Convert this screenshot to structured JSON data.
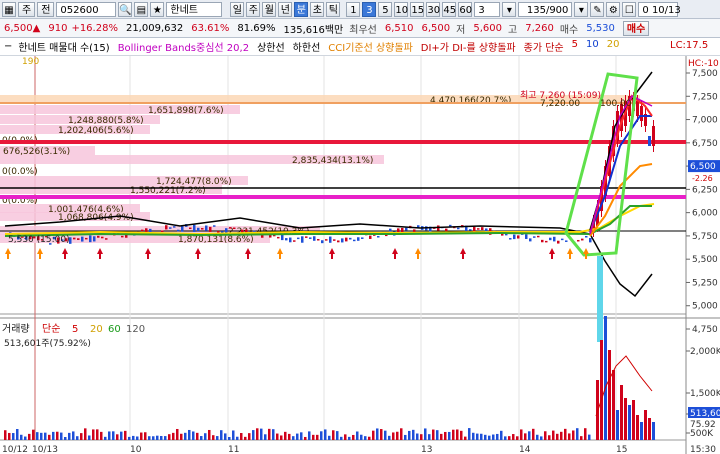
{
  "toolbar": {
    "menu_button": "주",
    "prev_button": "전",
    "stock_code": "052600",
    "stock_name": "한네트",
    "periods": [
      "일",
      "주",
      "월",
      "년",
      "분",
      "초",
      "틱"
    ],
    "active_period": "분",
    "intervals": [
      "1",
      "3",
      "5",
      "10",
      "15",
      "30",
      "45",
      "60"
    ],
    "active_interval": "3",
    "select_value": "3",
    "count": "135/900",
    "date_value": "0 10/13"
  },
  "quote": {
    "price": "6,500",
    "change": "910",
    "change_pct": "+16.28%",
    "volume": "21,009,632",
    "ratio1": "63.61%",
    "ratio2": "81.69%",
    "amount": "135,616백만",
    "best_label": "최우선",
    "best_sell": "6,510",
    "best_buy": "6,500",
    "low_label": "저",
    "low": "5,600",
    "high_label": "고",
    "high": "7,260",
    "ask_label": "매수",
    "ask_value": "5,530",
    "buy_button": "매수"
  },
  "indicators_bar": {
    "items": [
      {
        "text": "한네트 매물대 수(15)",
        "color": "#000000"
      },
      {
        "text": "Bollinger Bands중심선 20,2",
        "color": "#c000c0"
      },
      {
        "text": "상한선",
        "color": "#000000"
      },
      {
        "text": "하한선",
        "color": "#000000"
      },
      {
        "text": "CCI기준선 상향돌파",
        "color": "#e08000"
      },
      {
        "text": "DI+가 DI-를 상향돌파",
        "color": "#c00000"
      },
      {
        "text": "종가 단순",
        "color": "#c00000"
      },
      {
        "text": "5",
        "color": "#d00000"
      },
      {
        "text": "10",
        "color": "#1040d0"
      },
      {
        "text": "20",
        "color": "#d0a000"
      }
    ],
    "right_labels": [
      "LC:17.5",
      "HC:-10"
    ]
  },
  "price_axis": {
    "ticks": [
      "7,500",
      "7,250",
      "7,000",
      "6,750",
      "6,500",
      "6,250",
      "6,000",
      "5,750",
      "5,500",
      "5,250",
      "5,000",
      "4,750"
    ],
    "current": "6,500",
    "current_sub": "-2.26"
  },
  "volume_profile": [
    {
      "label": "1,651,898(7.6%)"
    },
    {
      "label": "1,248,880(5.8%)"
    },
    {
      "label": "1,202,406(5.6%)"
    },
    {
      "label": "0(0.0%)"
    },
    {
      "label": "676,526(3.1%)"
    },
    {
      "label": "2,835,434(13.1%)"
    },
    {
      "label": "0(0.0%)"
    },
    {
      "label": "1,724,477(8.0%)"
    },
    {
      "label": "1,550,221(7.2%)"
    },
    {
      "label": "0(0.0%)"
    },
    {
      "label": "1,001,476(4.6%)"
    },
    {
      "label": "1,068,806(4.9%)"
    },
    {
      "label": "2,231,452(10.3%)"
    },
    {
      "label": "1,870,131(8.6%)"
    },
    {
      "label": "4,470,166(20.7%)"
    }
  ],
  "annotations": {
    "high_label": "최고 7,260 (15:09)",
    "low_label": "5,530 (15:00)",
    "top_marker": "7,220.00",
    "top_marker2": "100.00",
    "left_top": "190"
  },
  "volume_panel": {
    "legend_label": "거래량",
    "legend_simple": "단순",
    "ma": [
      "5",
      "20",
      "60",
      "120"
    ],
    "value": "513,601주(75.92%)",
    "axis": [
      "2,000K",
      "1,500K",
      "1,000K",
      "500K"
    ],
    "axis_current": "513,60",
    "axis_current_pct": "75.92"
  },
  "date_axis": {
    "labels": [
      "10/12",
      "10/13",
      "10",
      "11",
      "13",
      "14",
      "15"
    ],
    "time": "15:30"
  },
  "colors": {
    "up": "#d0021b",
    "down": "#1d4fd8",
    "profile": "#f7c6dc",
    "highlight": "#5fe04a",
    "cyan": "#5fd6ea"
  }
}
